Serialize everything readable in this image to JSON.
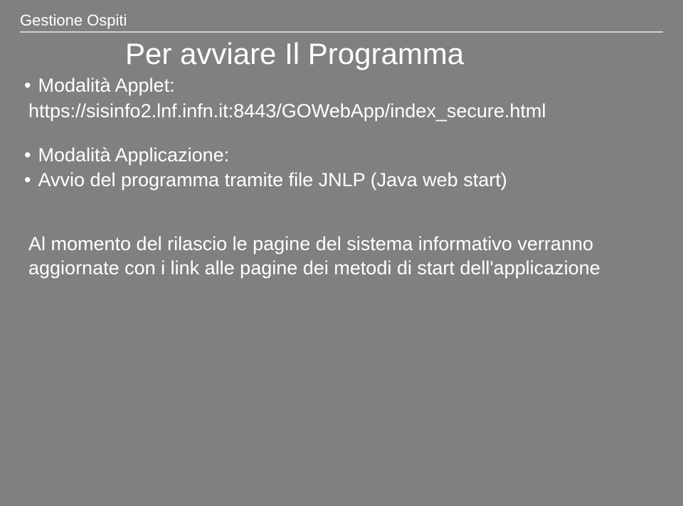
{
  "header": {
    "section": "Gestione Ospiti"
  },
  "title": "Per avviare Il Programma",
  "block1": {
    "bullet1": "Modalità Applet:",
    "line1": "https://sisinfo2.lnf.infn.it:8443/GOWebApp/index_secure.html"
  },
  "block2": {
    "bullet1": "Modalità Applicazione:",
    "bullet2": "Avvio del programma tramite file JNLP (Java web start)"
  },
  "block3": {
    "line1": "Al momento del rilascio le pagine del sistema informativo verranno aggiornate con i link alle pagine dei metodi di start dell'applicazione"
  }
}
